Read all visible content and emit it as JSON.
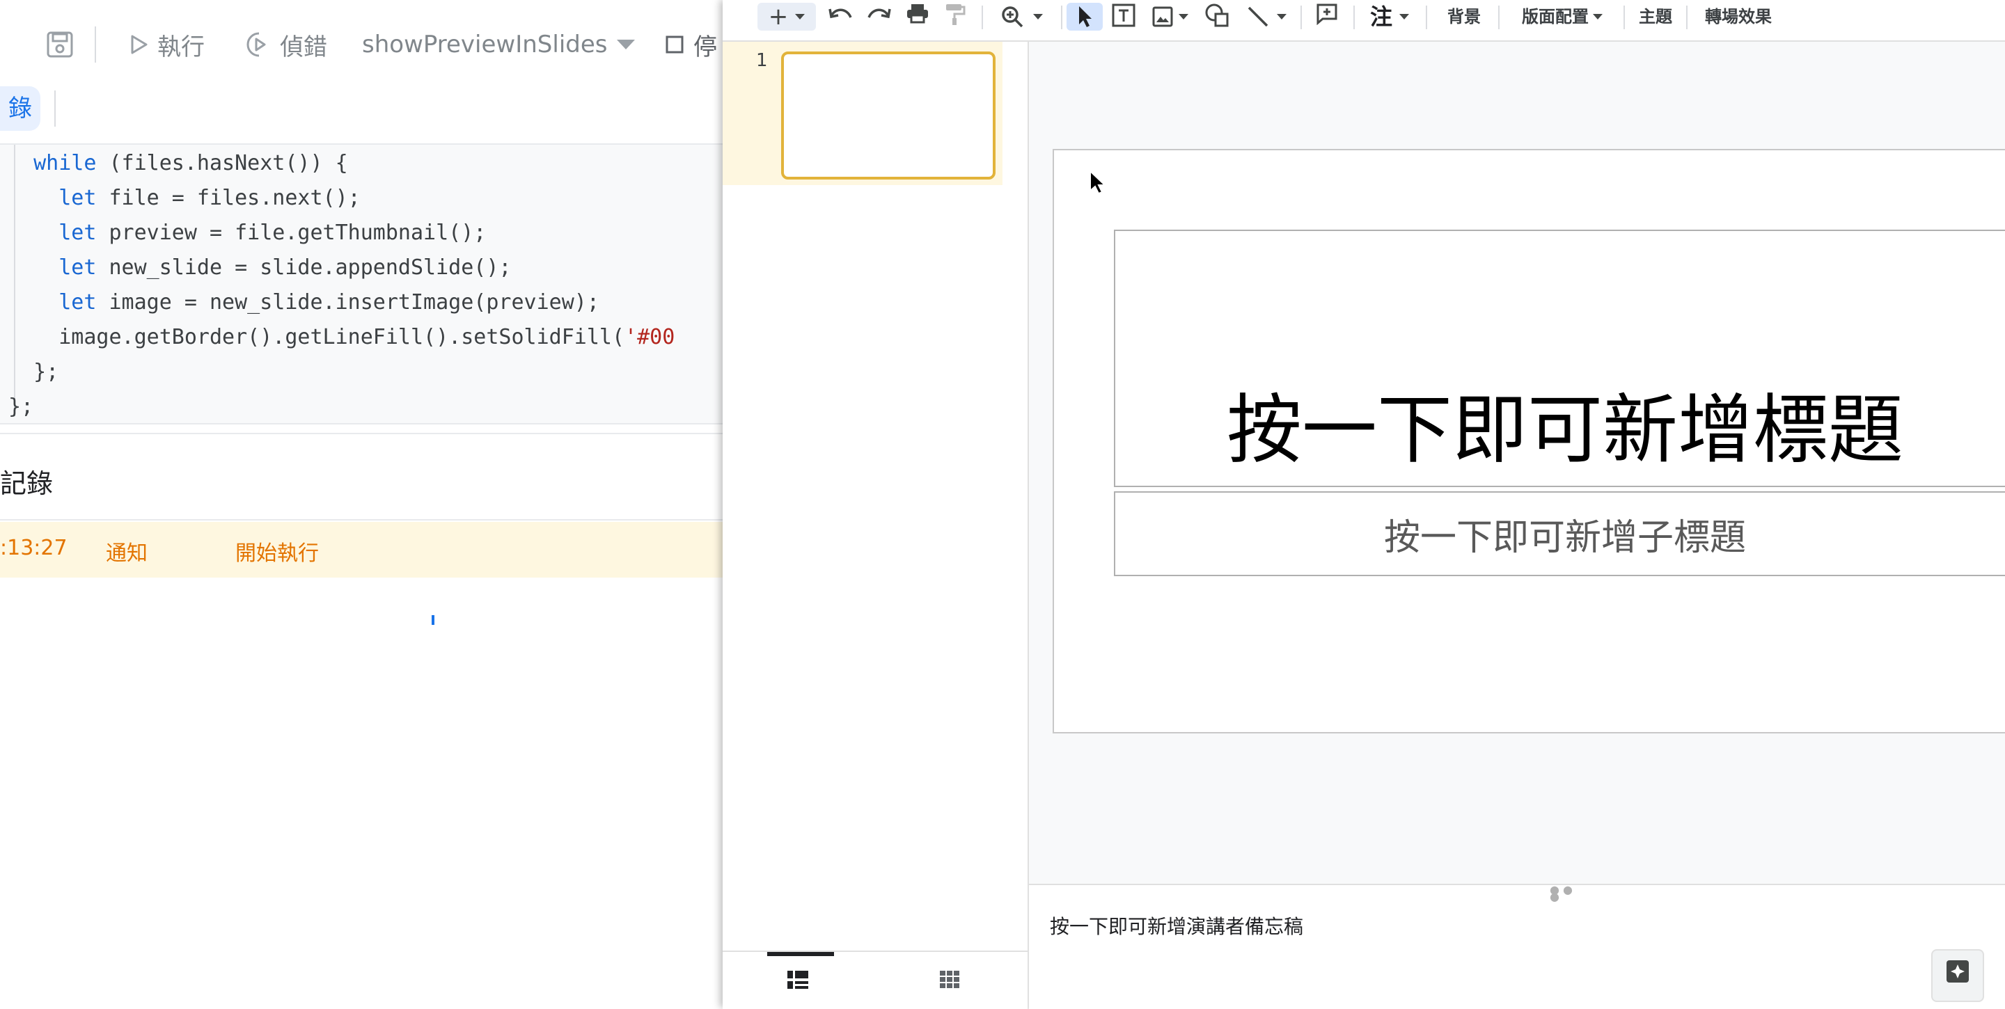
{
  "editor": {
    "toolbar": {
      "run_label": "執行",
      "debug_label": "偵錯",
      "function_name": "showPreviewInSlides",
      "stop_label": "停"
    },
    "log_chip_label": "錄",
    "code_lines": [
      {
        "indent": "  ",
        "kw": "while",
        "rest": " (files.hasNext()) {",
        "str": ""
      },
      {
        "indent": "    ",
        "kw": "let",
        "rest": " file = files.next();",
        "str": ""
      },
      {
        "indent": "    ",
        "kw": "let",
        "rest": " preview = file.getThumbnail();",
        "str": ""
      },
      {
        "indent": "    ",
        "kw": "let",
        "rest": " new_slide = slide.appendSlide();",
        "str": ""
      },
      {
        "indent": "    ",
        "kw": "let",
        "rest": " image = new_slide.insertImage(preview);",
        "str": ""
      },
      {
        "indent": "    ",
        "kw": "",
        "rest": "image.getBorder().getLineFill().setSolidFill(",
        "str": "'#00"
      },
      {
        "indent": "  ",
        "kw": "",
        "rest": "};",
        "str": ""
      },
      {
        "indent": "",
        "kw": "",
        "rest": "};",
        "str": ""
      }
    ],
    "log": {
      "title": "記錄",
      "entries": [
        {
          "time": ":13:27",
          "level": "通知",
          "message": "開始執行"
        }
      ]
    }
  },
  "slides": {
    "toolbar": {
      "add_icon": "+",
      "text_icon_label": "注",
      "background_label": "背景",
      "layout_label": "版面配置",
      "theme_label": "主題",
      "transition_label": "轉場效果"
    },
    "filmstrip": {
      "slide_number": "1"
    },
    "slide": {
      "title_placeholder": "按一下即可新增標題",
      "subtitle_placeholder": "按一下即可新增子標題"
    },
    "notes_placeholder": "按一下即可新增演講者備忘稿"
  }
}
